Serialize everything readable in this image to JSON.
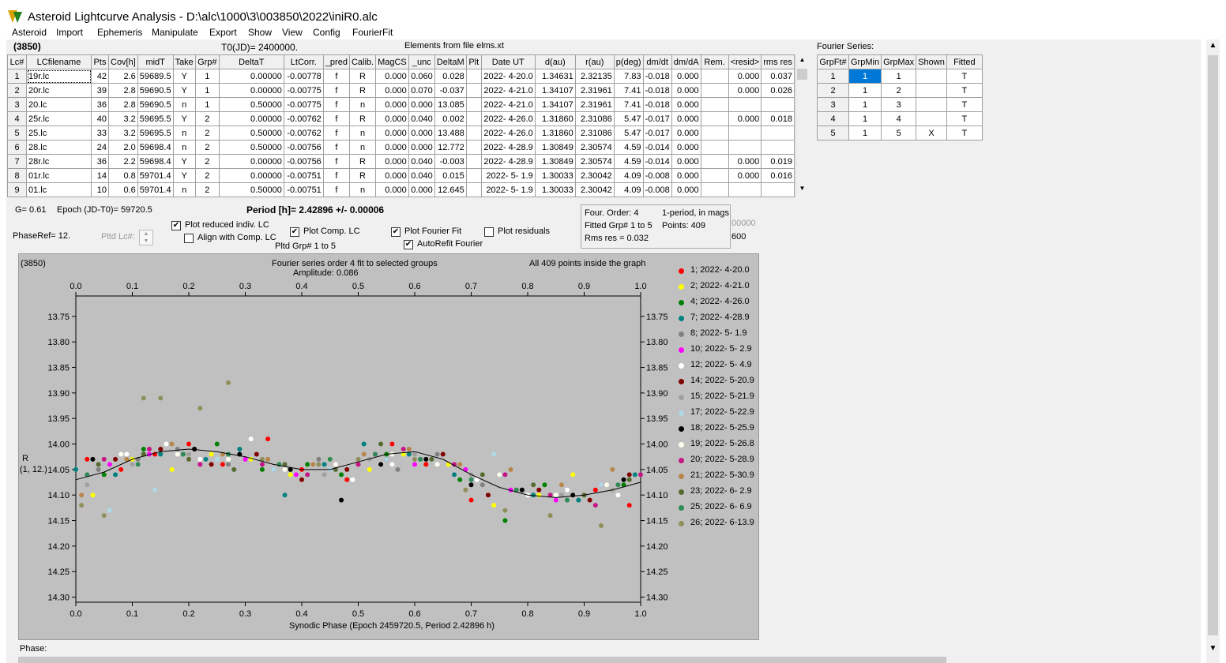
{
  "window": {
    "title": "Asteroid Lightcurve Analysis - D:\\alc\\1000\\3\\003850\\2022\\iniR0.alc"
  },
  "menu": [
    "Asteroid",
    "Import",
    "Ephemeris",
    "Manipulate",
    "Export",
    "Show",
    "View",
    "Config",
    "FourierFit"
  ],
  "header": {
    "asteroid": "(3850)",
    "t0": "T0(JD)= 2400000.",
    "elements": "Elements from file elms.xt",
    "fourier_series": "Fourier Series:"
  },
  "lc_table": {
    "columns": [
      "Lc#",
      "LCfilename",
      "Pts",
      "Cov[h]",
      "midT",
      "Take",
      "Grp#",
      "DeltaT",
      "LtCorr.",
      "_pred",
      "Calib.",
      "MagCS",
      "_unc",
      "DeltaM",
      "Plt",
      "Date UT",
      "d(au)",
      "r(au)",
      "p(deg)",
      "dm/dt",
      "dm/dA",
      "Rem.",
      "<resid>",
      "rms res"
    ],
    "rows": [
      [
        "1",
        "19r.lc",
        "42",
        "2.6",
        "59689.5",
        "Y",
        "1",
        "0.00000",
        "-0.00778",
        "f",
        "R",
        "0.000",
        "0.060",
        "0.028",
        "",
        "2022- 4-20.0",
        "1.34631",
        "2.32135",
        "7.83",
        "-0.018",
        "0.000",
        "",
        "0.000",
        "0.037"
      ],
      [
        "2",
        "20r.lc",
        "39",
        "2.8",
        "59690.5",
        "Y",
        "1",
        "0.00000",
        "-0.00775",
        "f",
        "R",
        "0.000",
        "0.070",
        "-0.037",
        "",
        "2022- 4-21.0",
        "1.34107",
        "2.31961",
        "7.41",
        "-0.018",
        "0.000",
        "",
        "0.000",
        "0.026"
      ],
      [
        "3",
        "20.lc",
        "36",
        "2.8",
        "59690.5",
        "n",
        "1",
        "0.50000",
        "-0.00775",
        "f",
        "n",
        "0.000",
        "0.000",
        "13.085",
        "",
        "2022- 4-21.0",
        "1.34107",
        "2.31961",
        "7.41",
        "-0.018",
        "0.000",
        "",
        "",
        ""
      ],
      [
        "4",
        "25r.lc",
        "40",
        "3.2",
        "59695.5",
        "Y",
        "2",
        "0.00000",
        "-0.00762",
        "f",
        "R",
        "0.000",
        "0.040",
        "0.002",
        "",
        "2022- 4-26.0",
        "1.31860",
        "2.31086",
        "5.47",
        "-0.017",
        "0.000",
        "",
        "0.000",
        "0.018"
      ],
      [
        "5",
        "25.lc",
        "33",
        "3.2",
        "59695.5",
        "n",
        "2",
        "0.50000",
        "-0.00762",
        "f",
        "n",
        "0.000",
        "0.000",
        "13.488",
        "",
        "2022- 4-26.0",
        "1.31860",
        "2.31086",
        "5.47",
        "-0.017",
        "0.000",
        "",
        "",
        ""
      ],
      [
        "6",
        "28.lc",
        "24",
        "2.0",
        "59698.4",
        "n",
        "2",
        "0.50000",
        "-0.00756",
        "f",
        "n",
        "0.000",
        "0.000",
        "12.772",
        "",
        "2022- 4-28.9",
        "1.30849",
        "2.30574",
        "4.59",
        "-0.014",
        "0.000",
        "",
        "",
        ""
      ],
      [
        "7",
        "28r.lc",
        "36",
        "2.2",
        "59698.4",
        "Y",
        "2",
        "0.00000",
        "-0.00756",
        "f",
        "R",
        "0.000",
        "0.040",
        "-0.003",
        "",
        "2022- 4-28.9",
        "1.30849",
        "2.30574",
        "4.59",
        "-0.014",
        "0.000",
        "",
        "0.000",
        "0.019"
      ],
      [
        "8",
        "01r.lc",
        "14",
        "0.8",
        "59701.4",
        "Y",
        "2",
        "0.00000",
        "-0.00751",
        "f",
        "R",
        "0.000",
        "0.040",
        "0.015",
        "",
        "2022- 5- 1.9",
        "1.30033",
        "2.30042",
        "4.09",
        "-0.008",
        "0.000",
        "",
        "0.000",
        "0.016"
      ],
      [
        "9",
        "01.lc",
        "10",
        "0.6",
        "59701.4",
        "n",
        "2",
        "0.50000",
        "-0.00751",
        "f",
        "n",
        "0.000",
        "0.000",
        "12.645",
        "",
        "2022- 5- 1.9",
        "1.30033",
        "2.30042",
        "4.09",
        "-0.008",
        "0.000",
        "",
        "",
        ""
      ]
    ]
  },
  "fs_table": {
    "columns": [
      "GrpFt#",
      "GrpMin",
      "GrpMax",
      "Shown",
      "Fitted"
    ],
    "rows": [
      [
        "1",
        "1",
        "1",
        "",
        "T"
      ],
      [
        "2",
        "1",
        "2",
        "",
        "T"
      ],
      [
        "3",
        "1",
        "3",
        "",
        "T"
      ],
      [
        "4",
        "1",
        "4",
        "",
        "T"
      ],
      [
        "5",
        "1",
        "5",
        "X",
        "T"
      ]
    ]
  },
  "controls": {
    "g": "G= 0.61",
    "epoch": "Epoch (JD-T0)= 59720.5",
    "period": "Period [h]= 2.42896 +/- 0.00006",
    "phaseref": "PhaseRef= 12.",
    "pltd_lc": "Pltd Lc#:",
    "plot_reduced": "Plot reduced indiv. LC",
    "align_comp": "Align with Comp. LC",
    "plot_comp": "Plot Comp. LC",
    "pltd_grp": "Pltd Grp#  1   to    5",
    "plot_fourier": "Plot Fourier Fit",
    "autorefit": "AutoRefit Fourier",
    "plot_residuals": "Plot residuals",
    "info": {
      "order": "Four. Order:  4",
      "mode": "1-period, in mags",
      "fitted": "Fitted Grp# 1 to 5",
      "points": "Points: 409",
      "rms": "Rms res     = 0.032",
      "side1": "00000",
      "side2": "600"
    }
  },
  "plot": {
    "id": "(3850)",
    "title": "Fourier series order 4 fit to selected groups",
    "amplitude": "Amplitude: 0.086",
    "inside": "All 409 points inside the graph",
    "ylabel1": "R",
    "ylabel2": "(1, 12.)",
    "xlabel": "Synodic Phase (Epoch 2459720.5, Period 2.42896 h)",
    "phase_label": "Phase:"
  },
  "chart_data": {
    "type": "scatter",
    "title": "Fourier series order 4 fit to selected groups",
    "xlabel": "Synodic Phase (Epoch 2459720.5, Period 2.42896 h)",
    "ylabel": "R (1, 12.)",
    "xlim": [
      0.0,
      1.0
    ],
    "ylim": [
      14.31,
      13.71
    ],
    "x_ticks": [
      "0.0",
      "0.1",
      "0.2",
      "0.3",
      "0.4",
      "0.5",
      "0.6",
      "0.7",
      "0.8",
      "0.9",
      "1.0"
    ],
    "y_ticks": [
      "13.75",
      "13.80",
      "13.85",
      "13.90",
      "13.95",
      "14.00",
      "14.05",
      "14.10",
      "14.15",
      "14.20",
      "14.25",
      "14.30"
    ],
    "fit_curve": {
      "x": [
        0.0,
        0.05,
        0.1,
        0.15,
        0.2,
        0.25,
        0.3,
        0.35,
        0.4,
        0.45,
        0.5,
        0.55,
        0.6,
        0.65,
        0.7,
        0.75,
        0.8,
        0.85,
        0.9,
        0.95,
        1.0
      ],
      "y": [
        14.07,
        14.055,
        14.03,
        14.015,
        14.01,
        14.015,
        14.025,
        14.04,
        14.05,
        14.05,
        14.035,
        14.02,
        14.015,
        14.03,
        14.06,
        14.085,
        14.1,
        14.105,
        14.1,
        14.09,
        14.075
      ]
    },
    "series": [
      {
        "name": "1; 2022- 4-20.0",
        "color": "#ff0000",
        "x": [
          0.02,
          0.08,
          0.14,
          0.2,
          0.26,
          0.34,
          0.4,
          0.48,
          0.56,
          0.62,
          0.7,
          0.78,
          0.84,
          0.92,
          0.98
        ],
        "y": [
          14.03,
          14.05,
          14.02,
          14.0,
          14.04,
          13.99,
          14.05,
          14.07,
          14.0,
          14.04,
          14.11,
          14.09,
          14.1,
          14.09,
          14.12
        ]
      },
      {
        "name": "2; 2022- 4-21.0",
        "color": "#ffff00",
        "x": [
          0.03,
          0.1,
          0.17,
          0.24,
          0.31,
          0.38,
          0.45,
          0.52,
          0.58,
          0.66,
          0.74,
          0.82,
          0.88,
          0.95
        ],
        "y": [
          14.1,
          14.03,
          14.05,
          14.02,
          14.03,
          14.06,
          14.03,
          14.05,
          14.02,
          14.04,
          14.12,
          14.1,
          14.06,
          14.09
        ]
      },
      {
        "name": "4; 2022- 4-26.0",
        "color": "#008000",
        "x": [
          0.05,
          0.12,
          0.19,
          0.25,
          0.33,
          0.41,
          0.47,
          0.55,
          0.61,
          0.68,
          0.76,
          0.83,
          0.9,
          0.97
        ],
        "y": [
          14.06,
          14.01,
          14.02,
          14.0,
          14.05,
          14.04,
          14.06,
          14.02,
          14.03,
          14.07,
          14.15,
          14.08,
          14.1,
          14.08
        ]
      },
      {
        "name": "7; 2022- 4-28.9",
        "color": "#008080",
        "x": [
          0.0,
          0.07,
          0.15,
          0.23,
          0.29,
          0.37,
          0.44,
          0.51,
          0.59,
          0.67,
          0.75,
          0.81,
          0.89,
          0.99
        ],
        "y": [
          14.05,
          14.06,
          14.02,
          14.03,
          14.01,
          14.1,
          14.04,
          14.0,
          14.02,
          14.06,
          14.06,
          14.1,
          14.11,
          14.06
        ]
      },
      {
        "name": "8; 2022- 5- 1.9",
        "color": "#808080",
        "x": [
          0.04,
          0.11,
          0.18,
          0.27,
          0.35,
          0.43,
          0.5,
          0.57,
          0.64,
          0.72,
          0.79,
          0.86,
          0.94
        ],
        "y": [
          14.05,
          14.03,
          14.01,
          14.04,
          14.05,
          14.03,
          14.04,
          14.05,
          14.02,
          14.08,
          14.09,
          14.1,
          14.08
        ]
      },
      {
        "name": "10; 2022- 5- 2.9",
        "color": "#ff00ff",
        "x": [
          0.06,
          0.13,
          0.21,
          0.3,
          0.39,
          0.46,
          0.53,
          0.6,
          0.69,
          0.77,
          0.85,
          0.93
        ],
        "y": [
          14.04,
          14.02,
          14.01,
          14.03,
          14.06,
          14.04,
          14.02,
          14.04,
          14.05,
          14.09,
          14.11,
          14.08
        ]
      },
      {
        "name": "12; 2022- 5- 4.9",
        "color": "#ffffff",
        "x": [
          0.09,
          0.16,
          0.22,
          0.31,
          0.42,
          0.49,
          0.56,
          0.63,
          0.71,
          0.8,
          0.87,
          0.96
        ],
        "y": [
          14.02,
          14.0,
          14.03,
          13.99,
          14.04,
          14.07,
          14.04,
          14.03,
          14.07,
          14.1,
          14.09,
          14.1
        ]
      },
      {
        "name": "14; 2022- 5-20.9",
        "color": "#800000",
        "x": [
          0.07,
          0.15,
          0.24,
          0.32,
          0.4,
          0.48,
          0.55,
          0.65,
          0.73,
          0.82,
          0.91,
          0.98
        ],
        "y": [
          14.03,
          14.01,
          14.04,
          14.02,
          14.07,
          14.05,
          14.03,
          14.02,
          14.1,
          14.09,
          14.11,
          14.06
        ]
      },
      {
        "name": "15; 2022- 5-21.9",
        "color": "#a0a0a0",
        "x": [
          0.02,
          0.1,
          0.2,
          0.28,
          0.36,
          0.44,
          0.52,
          0.6,
          0.7,
          0.78,
          0.86,
          0.95
        ],
        "y": [
          14.08,
          14.04,
          14.02,
          14.05,
          14.04,
          14.06,
          14.03,
          14.02,
          14.06,
          14.09,
          14.1,
          14.09
        ]
      },
      {
        "name": "17; 2022- 5-22.9",
        "color": "#add8e6",
        "x": [
          0.06,
          0.14,
          0.25,
          0.35,
          0.45,
          0.55,
          0.63,
          0.74,
          0.84,
          0.93
        ],
        "y": [
          14.13,
          14.09,
          14.03,
          14.05,
          14.05,
          14.03,
          14.03,
          14.02,
          14.1,
          14.08
        ]
      },
      {
        "name": "18; 2022- 5-25.9",
        "color": "#000000",
        "x": [
          0.03,
          0.12,
          0.21,
          0.29,
          0.38,
          0.47,
          0.54,
          0.62,
          0.7,
          0.79,
          0.88,
          0.97
        ],
        "y": [
          14.03,
          14.02,
          14.01,
          14.02,
          14.05,
          14.11,
          14.04,
          14.03,
          14.08,
          14.09,
          14.1,
          14.07
        ]
      },
      {
        "name": "19; 2022- 5-26.8",
        "color": "#fffff0",
        "x": [
          0.08,
          0.18,
          0.27,
          0.37,
          0.46,
          0.56,
          0.64,
          0.75,
          0.85,
          0.94
        ],
        "y": [
          14.02,
          14.02,
          14.03,
          14.05,
          14.04,
          14.02,
          14.04,
          14.06,
          14.1,
          14.08
        ]
      },
      {
        "name": "20; 2022- 5-28.9",
        "color": "#c71585",
        "x": [
          0.05,
          0.13,
          0.22,
          0.33,
          0.41,
          0.5,
          0.58,
          0.67,
          0.76,
          0.84,
          0.92,
          1.0
        ],
        "y": [
          14.03,
          14.01,
          14.04,
          14.04,
          14.06,
          14.04,
          14.01,
          14.04,
          14.06,
          14.1,
          14.12,
          14.06
        ]
      },
      {
        "name": "21; 2022- 5-30.9",
        "color": "#b8864b",
        "x": [
          0.01,
          0.09,
          0.17,
          0.26,
          0.34,
          0.42,
          0.51,
          0.59,
          0.68,
          0.77,
          0.86,
          0.95
        ],
        "y": [
          14.1,
          14.03,
          14.0,
          14.02,
          14.03,
          14.04,
          14.02,
          14.01,
          14.04,
          14.05,
          14.08,
          14.05
        ]
      },
      {
        "name": "23; 2022- 6- 2.9",
        "color": "#556b2f",
        "x": [
          0.04,
          0.12,
          0.2,
          0.28,
          0.37,
          0.46,
          0.54,
          0.63,
          0.72,
          0.81,
          0.9,
          0.98
        ],
        "y": [
          14.04,
          14.02,
          14.03,
          14.05,
          14.04,
          14.05,
          14.0,
          14.03,
          14.06,
          14.08,
          14.1,
          14.07
        ]
      },
      {
        "name": "25; 2022- 6- 6.9",
        "color": "#2e8b57",
        "x": [
          0.02,
          0.11,
          0.19,
          0.27,
          0.36,
          0.45,
          0.53,
          0.61,
          0.7,
          0.78,
          0.87,
          0.96
        ],
        "y": [
          14.06,
          14.04,
          14.02,
          14.02,
          14.04,
          14.03,
          14.02,
          14.03,
          14.07,
          14.09,
          14.11,
          14.08
        ]
      },
      {
        "name": "26; 2022- 6-13.9",
        "color": "#8f8f5a",
        "x": [
          0.01,
          0.05,
          0.12,
          0.15,
          0.22,
          0.27,
          0.33,
          0.43,
          0.5,
          0.6,
          0.69,
          0.76,
          0.84,
          0.93
        ],
        "y": [
          14.12,
          14.14,
          13.91,
          13.91,
          13.93,
          13.88,
          14.03,
          14.04,
          14.03,
          14.03,
          14.09,
          14.13,
          14.14,
          14.16
        ]
      }
    ]
  }
}
